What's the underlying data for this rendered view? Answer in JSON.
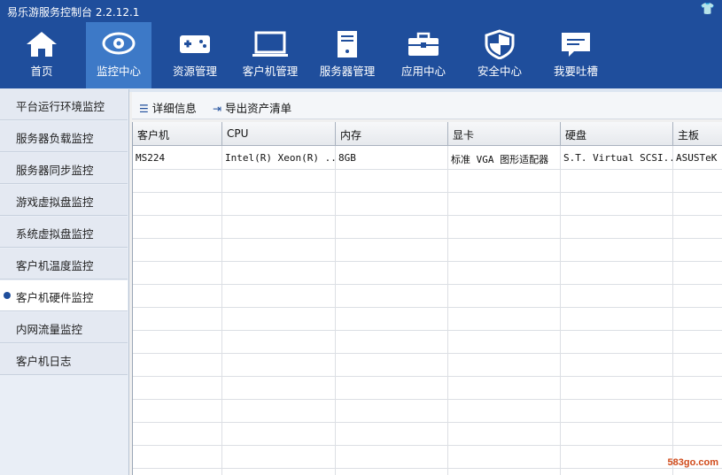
{
  "app": {
    "title": "易乐游服务控制台 2.2.12.1"
  },
  "nav": [
    {
      "label": "首页",
      "icon": "home-icon"
    },
    {
      "label": "监控中心",
      "icon": "eye-icon",
      "active": true
    },
    {
      "label": "资源管理",
      "icon": "gamepad-icon"
    },
    {
      "label": "客户机管理",
      "icon": "monitor-icon"
    },
    {
      "label": "服务器管理",
      "icon": "server-icon"
    },
    {
      "label": "应用中心",
      "icon": "toolbox-icon"
    },
    {
      "label": "安全中心",
      "icon": "shield-icon"
    },
    {
      "label": "我要吐槽",
      "icon": "feedback-icon"
    }
  ],
  "sidebar": {
    "items": [
      {
        "label": "平台运行环境监控"
      },
      {
        "label": "服务器负载监控"
      },
      {
        "label": "服务器同步监控"
      },
      {
        "label": "游戏虚拟盘监控"
      },
      {
        "label": "系统虚拟盘监控"
      },
      {
        "label": "客户机温度监控"
      },
      {
        "label": "客户机硬件监控",
        "active": true
      },
      {
        "label": "内网流量监控"
      },
      {
        "label": "客户机日志"
      }
    ]
  },
  "toolbar": {
    "details_label": "详细信息",
    "export_label": "导出资产清单"
  },
  "table": {
    "columns": [
      "客户机",
      "CPU",
      "内存",
      "显卡",
      "硬盘",
      "主板"
    ],
    "rows": [
      [
        "MS224",
        "Intel(R) Xeon(R) ...",
        "8GB",
        "标准 VGA 图形适配器",
        "S.T. Virtual SCSI...",
        "ASUSTeK C"
      ]
    ]
  },
  "watermark": "583go.com",
  "colors": {
    "nav_bg": "#1f4e9c",
    "nav_active": "#3d79c7",
    "accent": "#1f4e9c"
  }
}
